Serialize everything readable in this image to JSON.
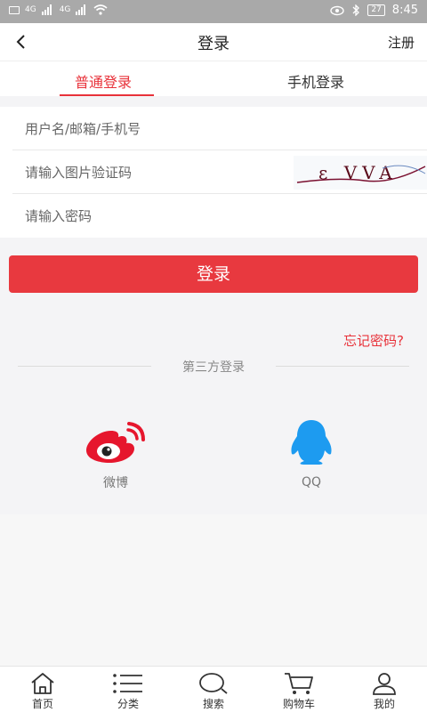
{
  "statusbar": {
    "time": "8:45",
    "battery": "27",
    "net1": "4G",
    "net2": "4G"
  },
  "nav": {
    "title": "登录",
    "register": "注册"
  },
  "tabs": {
    "normal": "普通登录",
    "phone": "手机登录"
  },
  "form": {
    "username_placeholder": "用户名/邮箱/手机号",
    "captcha_placeholder": "请输入图片验证码",
    "captcha_text": "ε VVA",
    "password_placeholder": "请输入密码"
  },
  "login_button": "登录",
  "forgot_password": "忘记密码?",
  "third_party": {
    "title": "第三方登录",
    "weibo": "微博",
    "qq": "QQ"
  },
  "tabbar": {
    "home": "首页",
    "category": "分类",
    "search": "搜索",
    "cart": "购物车",
    "mine": "我的"
  },
  "colors": {
    "accent": "#e8323a",
    "qq": "#1d9bf0",
    "weibo": "#e6162d"
  }
}
